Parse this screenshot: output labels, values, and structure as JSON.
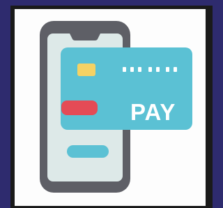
{
  "illustration": {
    "icon": "mobile-payment-icon",
    "card_label": "PAY",
    "colors": {
      "outer_background": "#2e2b6e",
      "tile_background": "#fdfdfd",
      "phone_body": "#5e5f66",
      "phone_screen": "#dde9e8",
      "card": "#5bc1d4",
      "card_chip": "#f5d264",
      "card_stripe": "#e44b56",
      "card_text": "#ffffff",
      "phone_button": "#5bc1d4"
    }
  }
}
